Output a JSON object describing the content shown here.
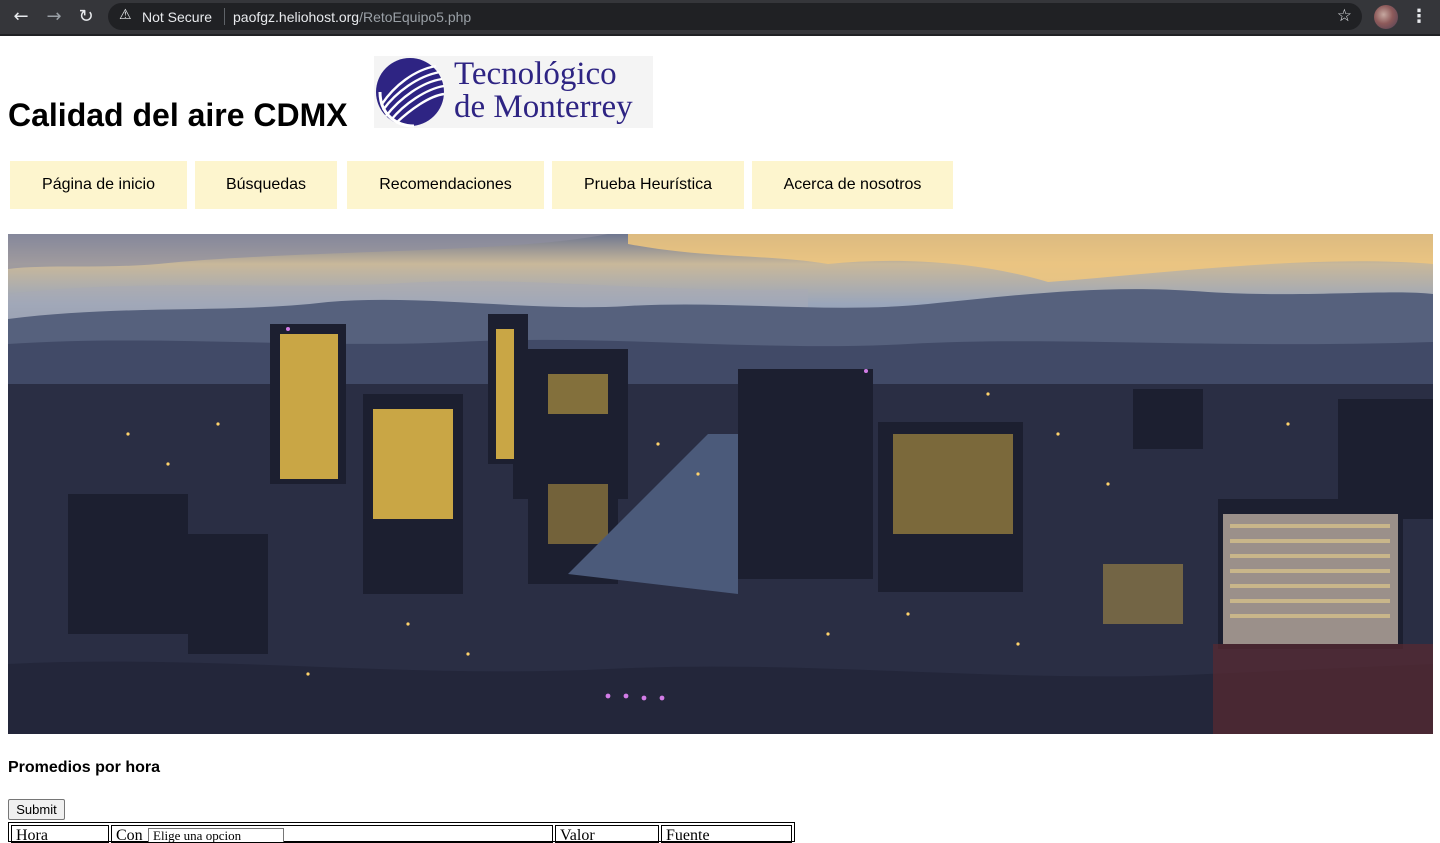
{
  "browser": {
    "nav": {
      "back_icon": "arrow-left-icon",
      "forward_icon": "arrow-right-icon",
      "reload_icon": "reload-icon"
    },
    "security_label": "Not Secure",
    "url_host": "paofgz.heliohost.org",
    "url_path": "/RetoEquipo5.php"
  },
  "header": {
    "title": "Calidad del aire CDMX",
    "logo": {
      "line1": "Tecnológico",
      "line2": "de Monterrey",
      "color": "#2e2483"
    }
  },
  "nav": {
    "items": [
      {
        "label": "Página de inicio"
      },
      {
        "label": "Búsquedas"
      },
      {
        "label": "Recomendaciones"
      },
      {
        "label": "Prueba Heurística"
      },
      {
        "label": "Acerca de nosotros"
      }
    ],
    "background": "#fdf5ce"
  },
  "content": {
    "section_heading": "Promedios por hora",
    "submit_label": "Submit",
    "table": {
      "headers": [
        "Hora",
        "Con",
        "Valor",
        "Fuente"
      ],
      "select_value": "Elige una opcion"
    }
  }
}
